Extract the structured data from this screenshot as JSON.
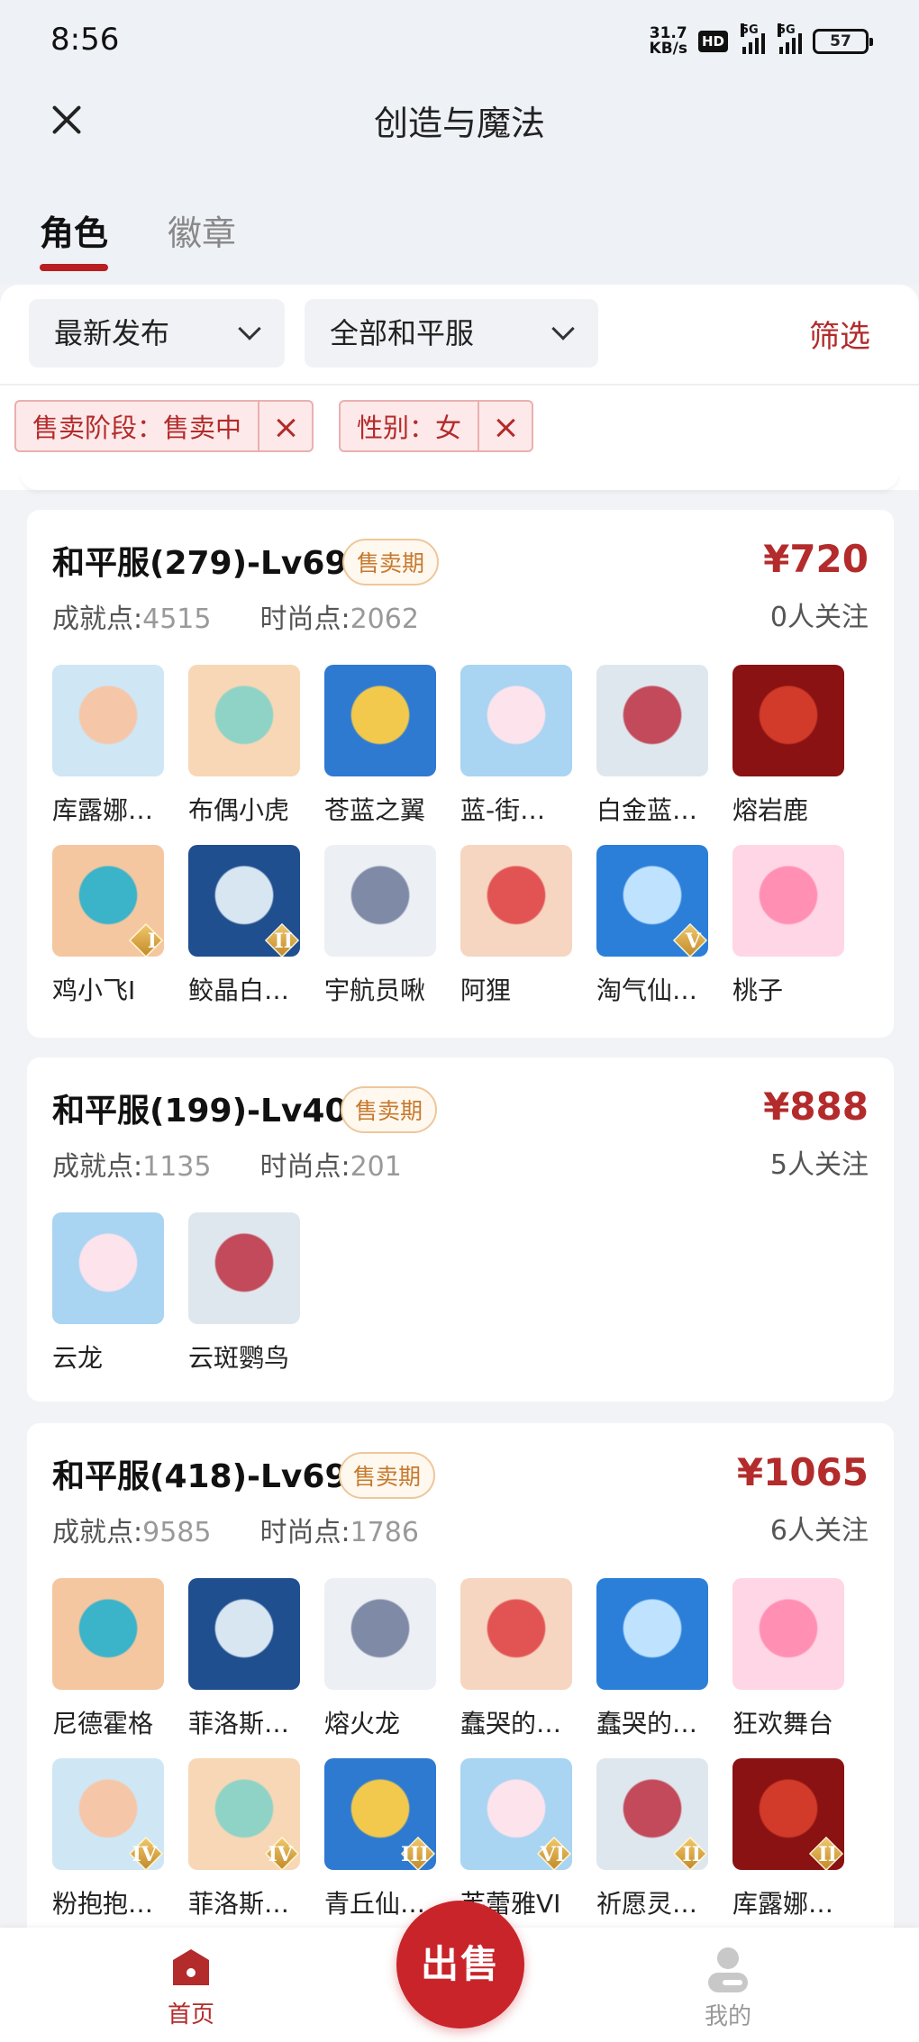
{
  "status": {
    "time": "8:56",
    "net_speed_top": "31.7",
    "net_speed_bottom": "KB/s",
    "hd": "HD",
    "signal1": "5G",
    "signal2": "5G",
    "battery": "57"
  },
  "header": {
    "title": "创造与魔法"
  },
  "tabs": [
    {
      "label": "角色"
    },
    {
      "label": "徽章"
    }
  ],
  "filters": {
    "sort": "最新发布",
    "server": "全部和平服",
    "filter_label": "筛选",
    "chips": [
      {
        "label": "售卖阶段：售卖中"
      },
      {
        "label": "性别：女"
      }
    ]
  },
  "listings": [
    {
      "title": "和平服(279)-Lv69",
      "badge": "售卖期",
      "price": "¥720",
      "followers": "0人关注",
      "achievement_label": "成就点:",
      "achievement": "4515",
      "fashion_label": "时尚点:",
      "fashion": "2062",
      "items": [
        {
          "name": "库露娜…",
          "rank": ""
        },
        {
          "name": "布偶小虎",
          "rank": ""
        },
        {
          "name": "苍蓝之翼",
          "rank": ""
        },
        {
          "name": "蓝-街…",
          "rank": ""
        },
        {
          "name": "白金蓝…",
          "rank": ""
        },
        {
          "name": "熔岩鹿",
          "rank": ""
        },
        {
          "name": "鸡小飞I",
          "rank": "I"
        },
        {
          "name": "鲛晶白…",
          "rank": "II"
        },
        {
          "name": "宇航员啾",
          "rank": ""
        },
        {
          "name": "阿狸",
          "rank": ""
        },
        {
          "name": "淘气仙…",
          "rank": "V"
        },
        {
          "name": "桃子",
          "rank": ""
        }
      ]
    },
    {
      "title": "和平服(199)-Lv40",
      "badge": "售卖期",
      "price": "¥888",
      "followers": "5人关注",
      "achievement_label": "成就点:",
      "achievement": "1135",
      "fashion_label": "时尚点:",
      "fashion": "201",
      "items": [
        {
          "name": "云龙",
          "rank": ""
        },
        {
          "name": "云斑鹦鸟",
          "rank": ""
        }
      ]
    },
    {
      "title": "和平服(418)-Lv69",
      "badge": "售卖期",
      "price": "¥1065",
      "followers": "6人关注",
      "achievement_label": "成就点:",
      "achievement": "9585",
      "fashion_label": "时尚点:",
      "fashion": "1786",
      "items": [
        {
          "name": "尼德霍格",
          "rank": ""
        },
        {
          "name": "菲洛斯…",
          "rank": ""
        },
        {
          "name": "熔火龙",
          "rank": ""
        },
        {
          "name": "蠢哭的…",
          "rank": ""
        },
        {
          "name": "蠢哭的…",
          "rank": ""
        },
        {
          "name": "狂欢舞台",
          "rank": ""
        },
        {
          "name": "粉抱抱…",
          "rank": "IV"
        },
        {
          "name": "菲洛斯…",
          "rank": "IV"
        },
        {
          "name": "青丘仙…",
          "rank": "III"
        },
        {
          "name": "芙蕾雅VI",
          "rank": "VI"
        },
        {
          "name": "祈愿灵…",
          "rank": "II"
        },
        {
          "name": "库露娜…",
          "rank": "II"
        }
      ]
    }
  ],
  "bottom_nav": {
    "home": "首页",
    "sell": "出售",
    "me": "我的"
  },
  "colors": {
    "accent": "#b32b2b",
    "sell_button": "#c8242a",
    "badge": "#c6792d"
  },
  "icons": {
    "close": "close-icon",
    "chevron": "chevron-down-icon",
    "home": "home-icon",
    "me": "user-icon"
  }
}
